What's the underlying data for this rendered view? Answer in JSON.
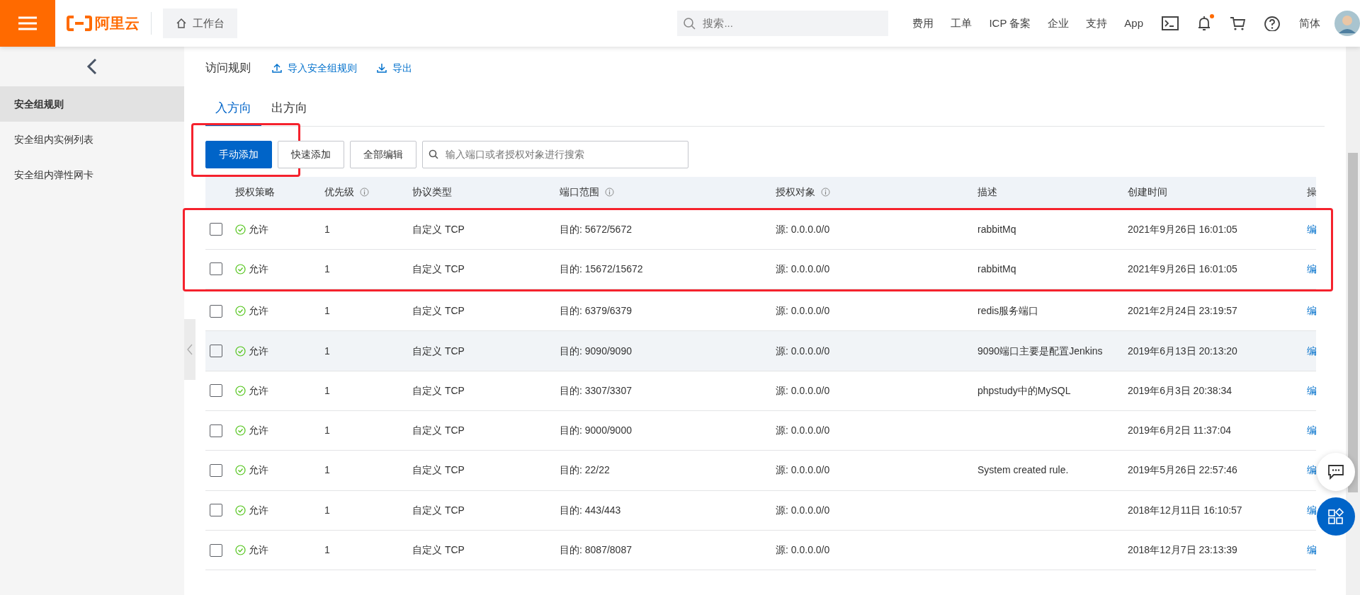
{
  "topbar": {
    "logo": "阿里云",
    "workbench": "工作台",
    "search_placeholder": "搜索...",
    "nav": [
      {
        "label": "费用"
      },
      {
        "label": "工单"
      },
      {
        "label": "ICP 备案"
      },
      {
        "label": "企业"
      },
      {
        "label": "支持"
      },
      {
        "label": "App"
      }
    ],
    "has_notification": true,
    "language": "简体"
  },
  "sidebar": {
    "items": [
      {
        "label": "安全组规则",
        "selected": true
      },
      {
        "label": "安全组内实例列表",
        "selected": false
      },
      {
        "label": "安全组内弹性网卡",
        "selected": false
      }
    ]
  },
  "header": {
    "title": "访问规则",
    "links": [
      {
        "label": "导入安全组规则",
        "kind": "upload"
      },
      {
        "label": "导出",
        "kind": "download"
      }
    ]
  },
  "tabs": [
    {
      "label": "入方向",
      "selected": true
    },
    {
      "label": "出方向",
      "selected": false
    }
  ],
  "toolbar": {
    "buttons": [
      {
        "label": "手动添加",
        "kind": "primary",
        "highlighted": true
      },
      {
        "label": "快速添加",
        "kind": "default",
        "highlighted": false
      },
      {
        "label": "全部编辑",
        "kind": "default",
        "highlighted": false
      }
    ],
    "search": {
      "placeholder": "输入端口或者授权对象进行搜索"
    }
  },
  "table": {
    "columns": [
      {
        "label": "授权策略",
        "info": false
      },
      {
        "label": "优先级",
        "info": true
      },
      {
        "label": "协议类型",
        "info": false
      },
      {
        "label": "端口范围",
        "info": true
      },
      {
        "label": "授权对象",
        "info": true
      },
      {
        "label": "描述",
        "info": false
      },
      {
        "label": "创建时间",
        "info": false
      },
      {
        "label": "操",
        "info": false
      }
    ],
    "rows": [
      {
        "checked": false,
        "hovered": false,
        "highlighted": true,
        "policy": "允许",
        "priority": "1",
        "protocol": "自定义 TCP",
        "port": "目的: 5672/5672",
        "source": "源: 0.0.0.0/0",
        "description": "rabbitMq",
        "created": "2021年9月26日 16:01:05",
        "action": "编"
      },
      {
        "checked": false,
        "hovered": false,
        "highlighted": true,
        "policy": "允许",
        "priority": "1",
        "protocol": "自定义 TCP",
        "port": "目的: 15672/15672",
        "source": "源: 0.0.0.0/0",
        "description": "rabbitMq",
        "created": "2021年9月26日 16:01:05",
        "action": "编"
      },
      {
        "checked": false,
        "hovered": false,
        "highlighted": false,
        "policy": "允许",
        "priority": "1",
        "protocol": "自定义 TCP",
        "port": "目的: 6379/6379",
        "source": "源: 0.0.0.0/0",
        "description": "redis服务端口",
        "created": "2021年2月24日 23:19:57",
        "action": "编"
      },
      {
        "checked": false,
        "hovered": true,
        "highlighted": false,
        "policy": "允许",
        "priority": "1",
        "protocol": "自定义 TCP",
        "port": "目的: 9090/9090",
        "source": "源: 0.0.0.0/0",
        "description": "9090端口主要是配置Jenkins",
        "created": "2019年6月13日 20:13:20",
        "action": "编"
      },
      {
        "checked": false,
        "hovered": false,
        "highlighted": false,
        "policy": "允许",
        "priority": "1",
        "protocol": "自定义 TCP",
        "port": "目的: 3307/3307",
        "source": "源: 0.0.0.0/0",
        "description": "phpstudy中的MySQL",
        "created": "2019年6月3日 20:38:34",
        "action": "编"
      },
      {
        "checked": false,
        "hovered": false,
        "highlighted": false,
        "policy": "允许",
        "priority": "1",
        "protocol": "自定义 TCP",
        "port": "目的: 9000/9000",
        "source": "源: 0.0.0.0/0",
        "created": "2019年6月2日 11:37:04",
        "action": "编"
      },
      {
        "checked": false,
        "hovered": false,
        "highlighted": false,
        "policy": "允许",
        "priority": "1",
        "protocol": "自定义 TCP",
        "port": "目的: 22/22",
        "source": "源: 0.0.0.0/0",
        "description": "System created rule.",
        "created": "2019年5月26日 22:57:46",
        "action": "编"
      },
      {
        "checked": false,
        "hovered": false,
        "highlighted": false,
        "policy": "允许",
        "priority": "1",
        "protocol": "自定义 TCP",
        "port": "目的: 443/443",
        "source": "源: 0.0.0.0/0",
        "created": "2018年12月11日 16:10:57",
        "action": "编"
      },
      {
        "checked": false,
        "hovered": false,
        "highlighted": false,
        "policy": "允许",
        "priority": "1",
        "protocol": "自定义 TCP",
        "port": "目的: 8087/8087",
        "source": "源: 0.0.0.0/0",
        "created": "2018年12月7日 23:13:39",
        "action": "编"
      }
    ]
  }
}
